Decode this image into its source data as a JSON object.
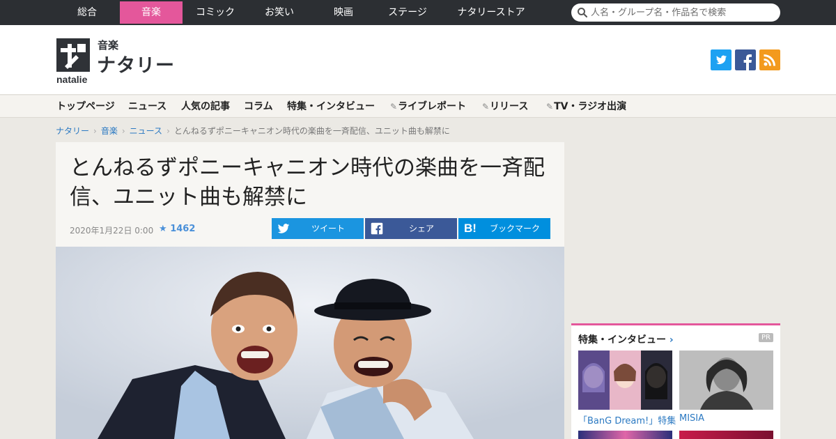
{
  "top_nav": {
    "tabs": [
      "総合",
      "音楽",
      "コミック",
      "お笑い",
      "映画",
      "ステージ",
      "ナタリーストア"
    ],
    "active": "音楽"
  },
  "search": {
    "placeholder": "人名・グループ名・作品名で検索"
  },
  "logo": {
    "sub": "音楽",
    "main": "ナタリー",
    "latin": "natalie"
  },
  "social": [
    "twitter-icon",
    "facebook-icon",
    "rss-icon"
  ],
  "sub_nav": [
    "トップページ",
    "ニュース",
    "人気の記事",
    "コラム",
    "特集・インタビュー",
    "ライブレポート",
    "リリース",
    "TV・ラジオ出演"
  ],
  "breadcrumb": [
    "ナタリー",
    "音楽",
    "ニュース",
    "とんねるずポニーキャニオン時代の楽曲を一斉配信、ユニット曲も解禁に"
  ],
  "article": {
    "title": "とんねるずポニーキャニオン時代の楽曲を一斉配信、ユニット曲も解禁に",
    "date": "2020年1月22日 0:00",
    "stars": "1462",
    "share": {
      "tweet": "ツイート",
      "facebook": "シェア",
      "hatena": "ブックマーク"
    }
  },
  "sidebar": {
    "heading": "特集・インタビュー",
    "pr": "PR",
    "items": [
      {
        "caption": "「BanG Dream!」特集"
      },
      {
        "caption": "MISIA"
      }
    ]
  },
  "colors": {
    "accent": "#e4579b",
    "twitter": "#1da1f2",
    "facebook": "#3b5998",
    "rss": "#f39a1d",
    "share_tweet": "#1b95e0",
    "share_fb": "#3b5998",
    "share_hatena": "#008fde"
  }
}
